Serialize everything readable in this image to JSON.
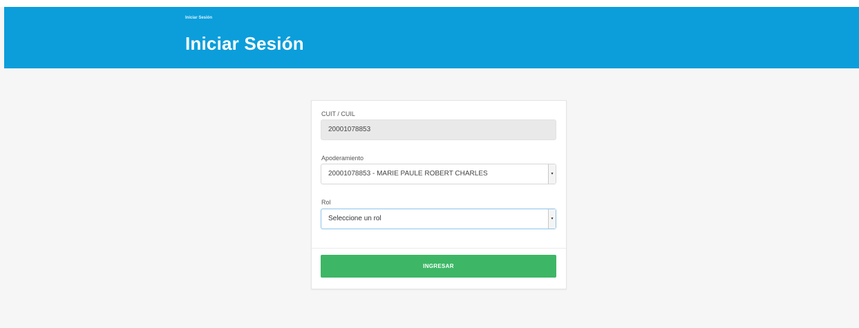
{
  "header": {
    "breadcrumb": "Iniciar Sesión",
    "title": "Iniciar Sesión",
    "bg_color": "#0b9edb"
  },
  "form": {
    "cuit_label": "CUIT / CUIL",
    "cuit_value": "20001078853",
    "apoderamiento_label": "Apoderamiento",
    "apoderamiento_value": "20001078853 - MARIE PAULE ROBERT CHARLES",
    "rol_label": "Rol",
    "rol_value": "Seleccione un rol",
    "submit_label": "INGRESAR",
    "submit_color": "#3db765"
  },
  "icons": {
    "select_arrow": "chevron-down-icon"
  }
}
